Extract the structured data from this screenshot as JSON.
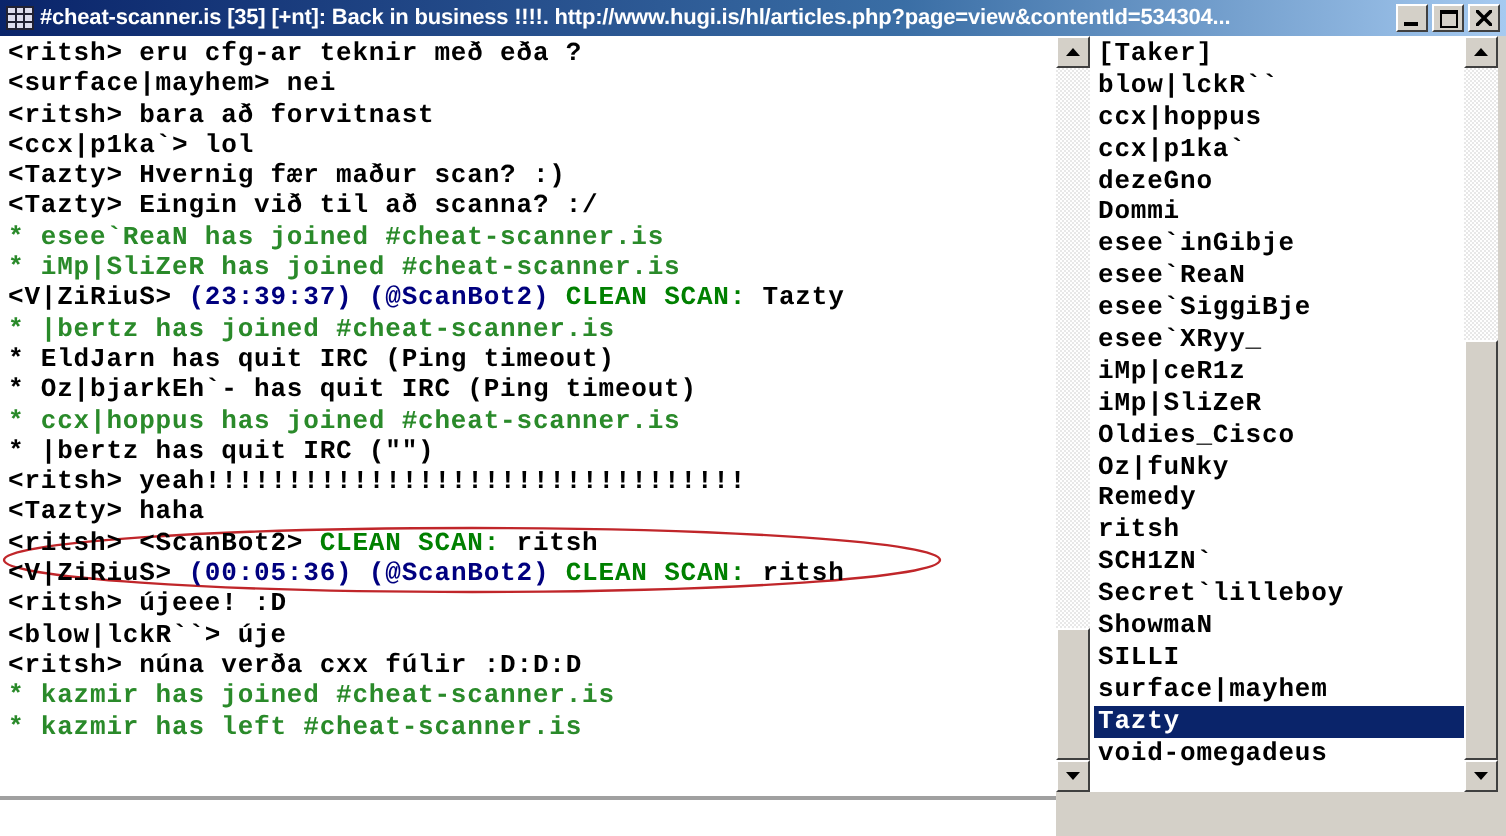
{
  "window": {
    "title": "#cheat-scanner.is [35] [+nt]: Back in business !!!!. http://www.hugi.is/hl/articles.php?page=view&contentId=534304..."
  },
  "chat": {
    "lines": [
      {
        "segments": [
          {
            "kind": "text",
            "text": "<ritsh> eru cfg-ar teknir með eða ?"
          }
        ]
      },
      {
        "segments": [
          {
            "kind": "text",
            "text": "<surface|mayhem> nei"
          }
        ]
      },
      {
        "segments": [
          {
            "kind": "text",
            "text": "<ritsh> bara að forvitnast"
          }
        ]
      },
      {
        "segments": [
          {
            "kind": "text",
            "text": "<ccx|p1ka`> lol"
          }
        ]
      },
      {
        "segments": [
          {
            "kind": "text",
            "text": "<Tazty> Hvernig fær maður scan? :)"
          }
        ]
      },
      {
        "segments": [
          {
            "kind": "text",
            "text": "<Tazty> Eingin við til að scanna? :/"
          }
        ]
      },
      {
        "segments": [
          {
            "kind": "event",
            "text": "* esee`ReaN has joined #cheat-scanner.is"
          }
        ]
      },
      {
        "segments": [
          {
            "kind": "event",
            "text": "* iMp|SliZeR has joined #cheat-scanner.is"
          }
        ]
      },
      {
        "segments": [
          {
            "kind": "text",
            "text": "<V|ZiRiuS> "
          },
          {
            "kind": "time",
            "text": "(23:39:37) (@ScanBot2) "
          },
          {
            "kind": "scan",
            "text": "CLEAN SCAN: "
          },
          {
            "kind": "text",
            "text": "Tazty"
          }
        ]
      },
      {
        "segments": [
          {
            "kind": "event",
            "text": "* |bertz has joined #cheat-scanner.is"
          }
        ]
      },
      {
        "segments": [
          {
            "kind": "text",
            "text": "* EldJarn has quit IRC (Ping timeout)"
          }
        ]
      },
      {
        "segments": [
          {
            "kind": "text",
            "text": "* Oz|bjarkEh`- has quit IRC (Ping timeout)"
          }
        ]
      },
      {
        "segments": [
          {
            "kind": "event",
            "text": "* ccx|hoppus has joined #cheat-scanner.is"
          }
        ]
      },
      {
        "segments": [
          {
            "kind": "text",
            "text": "* |bertz has quit IRC (\"\")"
          }
        ]
      },
      {
        "segments": [
          {
            "kind": "text",
            "text": "<ritsh> yeah!!!!!!!!!!!!!!!!!!!!!!!!!!!!!!!!!"
          }
        ]
      },
      {
        "segments": [
          {
            "kind": "text",
            "text": "<Tazty> haha"
          }
        ]
      },
      {
        "segments": [
          {
            "kind": "text",
            "text": "<ritsh> <ScanBot2> "
          },
          {
            "kind": "scan",
            "text": "CLEAN SCAN: "
          },
          {
            "kind": "text",
            "text": "ritsh"
          }
        ]
      },
      {
        "segments": [
          {
            "kind": "text",
            "text": "<V|ZiRiuS> "
          },
          {
            "kind": "time",
            "text": "(00:05:36) (@ScanBot2) "
          },
          {
            "kind": "scan",
            "text": "CLEAN SCAN: "
          },
          {
            "kind": "text",
            "text": "ritsh"
          }
        ]
      },
      {
        "segments": [
          {
            "kind": "text",
            "text": "<ritsh> újeee! :D"
          }
        ]
      },
      {
        "segments": [
          {
            "kind": "text",
            "text": "<blow|lckR``> úje"
          }
        ]
      },
      {
        "segments": [
          {
            "kind": "text",
            "text": "<ritsh> núna verða cxx fúlir :D:D:D"
          }
        ]
      },
      {
        "segments": [
          {
            "kind": "event",
            "text": "* kazmir has joined #cheat-scanner.is"
          }
        ]
      },
      {
        "segments": [
          {
            "kind": "event",
            "text": "* kazmir has left #cheat-scanner.is"
          }
        ]
      }
    ]
  },
  "nicklist": [
    {
      "nick": "[Taker]",
      "selected": false
    },
    {
      "nick": "blow|lckR``",
      "selected": false
    },
    {
      "nick": "ccx|hoppus",
      "selected": false
    },
    {
      "nick": "ccx|p1ka`",
      "selected": false
    },
    {
      "nick": "dezeGno",
      "selected": false
    },
    {
      "nick": "Dommi",
      "selected": false
    },
    {
      "nick": "esee`inGibje",
      "selected": false
    },
    {
      "nick": "esee`ReaN",
      "selected": false
    },
    {
      "nick": "esee`SiggiBje",
      "selected": false
    },
    {
      "nick": "esee`XRyy_",
      "selected": false
    },
    {
      "nick": "iMp|ceR1z",
      "selected": false
    },
    {
      "nick": "iMp|SliZeR",
      "selected": false
    },
    {
      "nick": "Oldies_Cisco",
      "selected": false
    },
    {
      "nick": "Oz|fuNky",
      "selected": false
    },
    {
      "nick": "Remedy",
      "selected": false
    },
    {
      "nick": "ritsh",
      "selected": false
    },
    {
      "nick": "SCH1ZN`",
      "selected": false
    },
    {
      "nick": "Secret`lilleboy",
      "selected": false
    },
    {
      "nick": "ShowmaN",
      "selected": false
    },
    {
      "nick": "SILLI",
      "selected": false
    },
    {
      "nick": "surface|mayhem",
      "selected": false
    },
    {
      "nick": "Tazty",
      "selected": true
    },
    {
      "nick": "void-omegadeus",
      "selected": false
    }
  ]
}
